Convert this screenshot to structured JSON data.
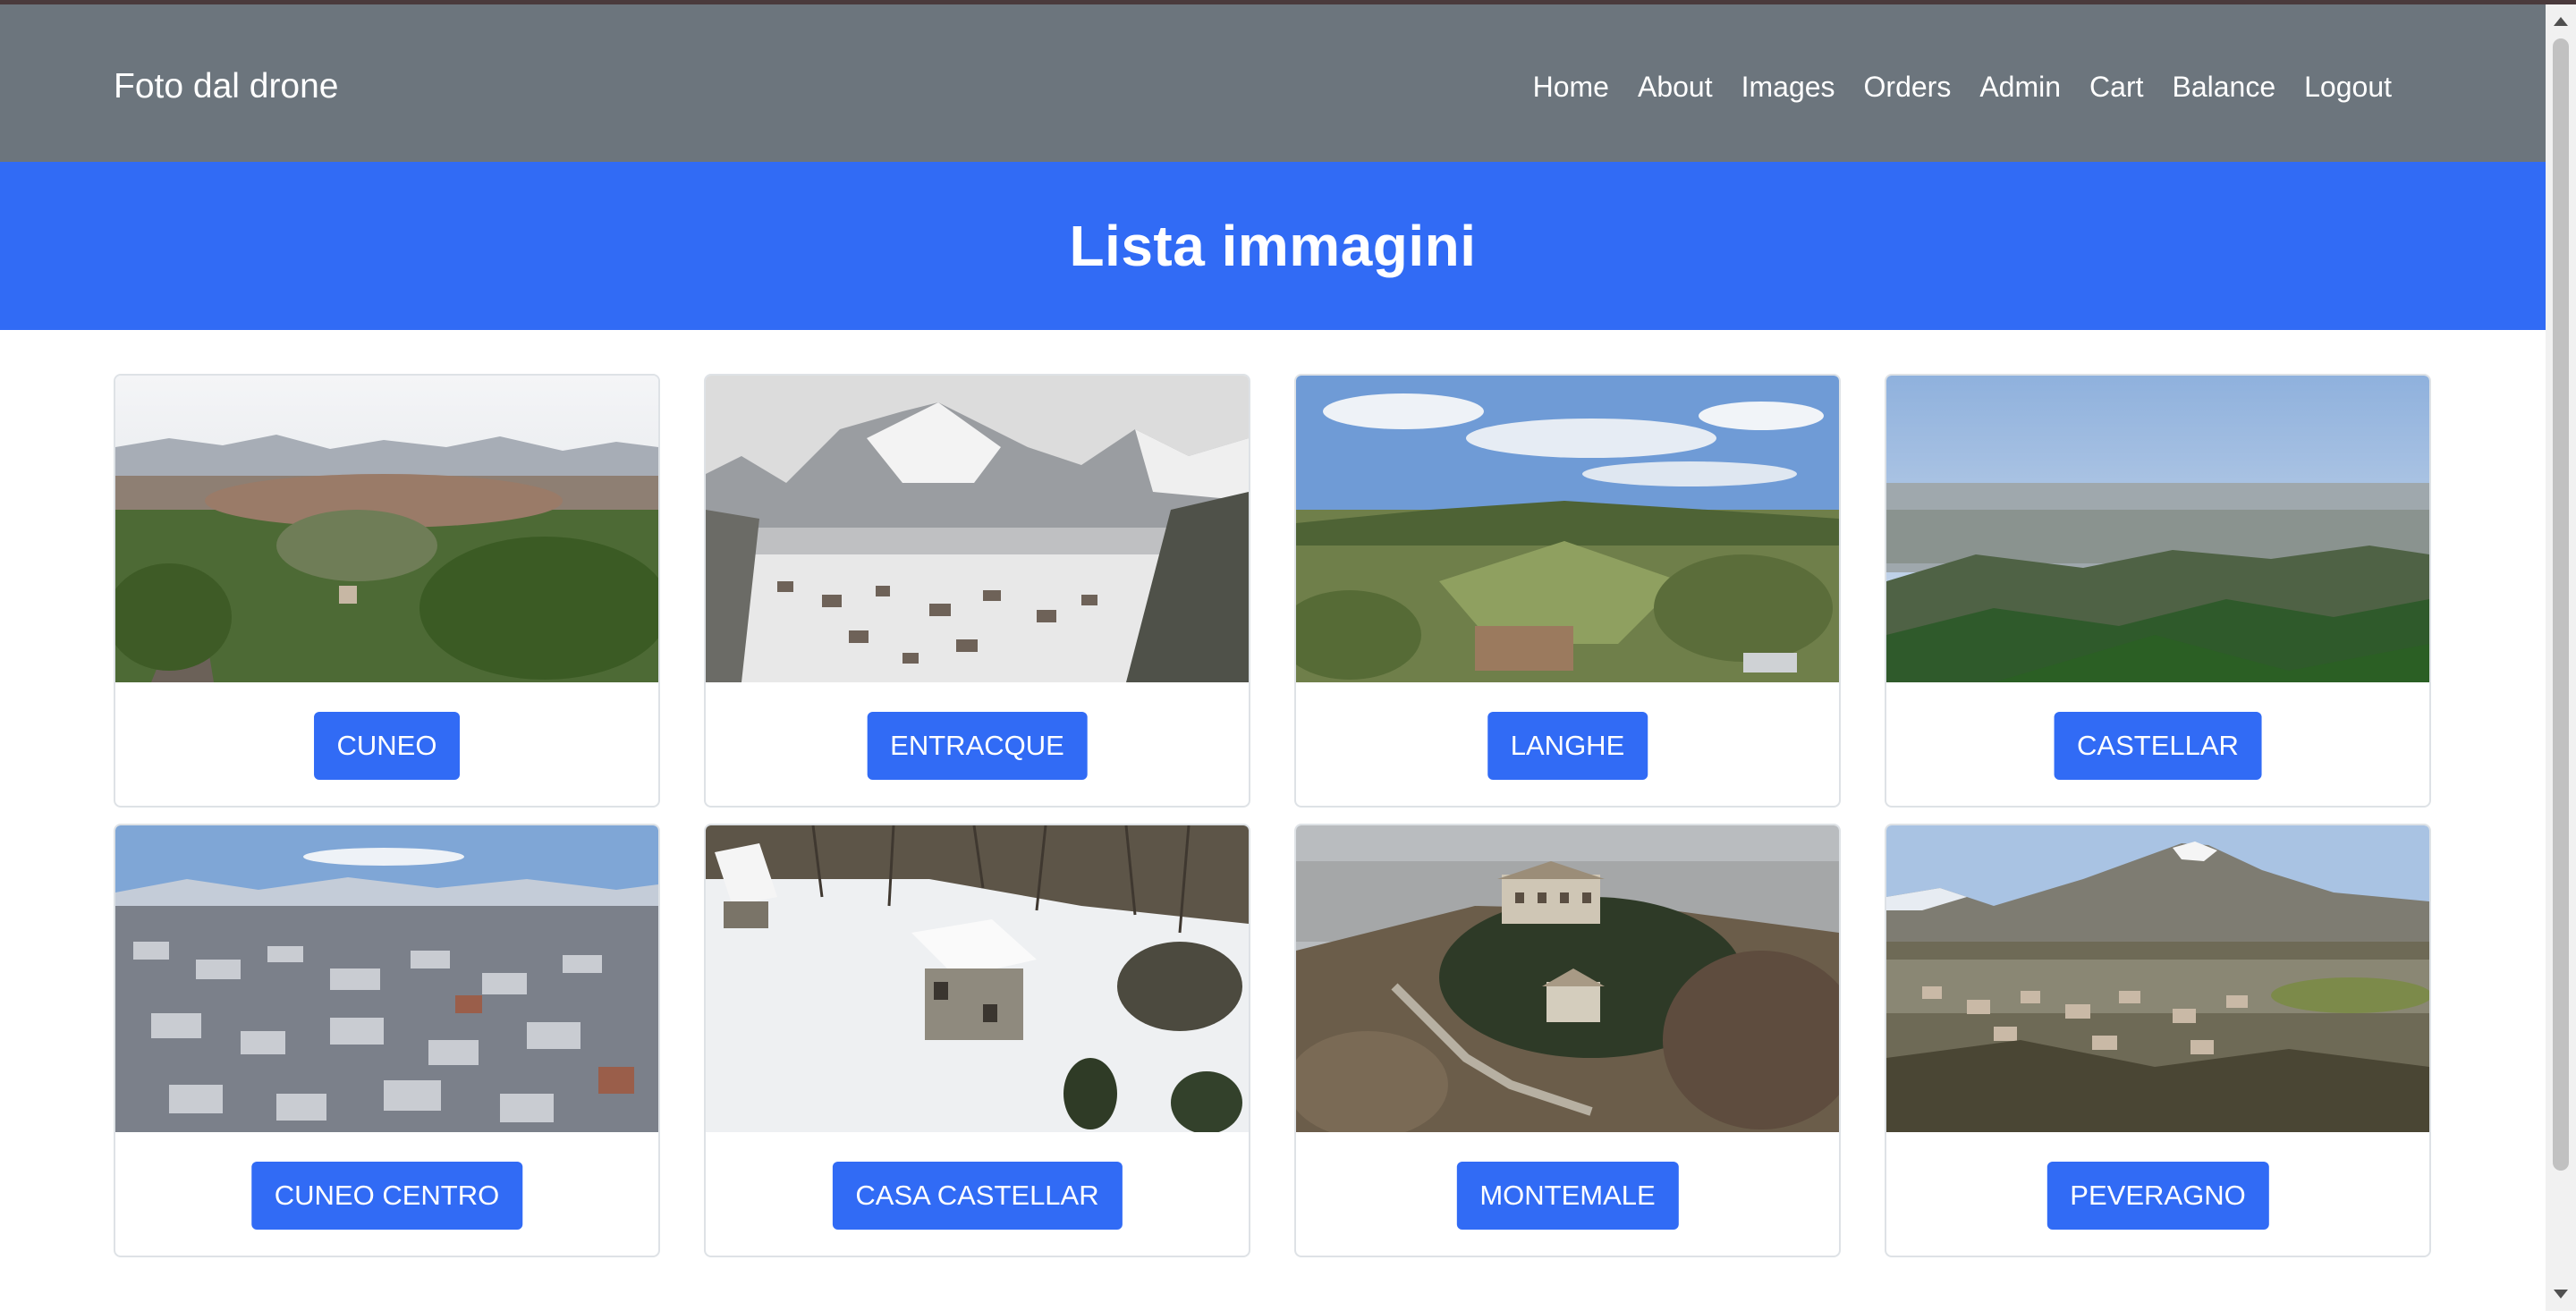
{
  "navbar": {
    "brand": "Foto dal drone",
    "links": [
      "Home",
      "About",
      "Images",
      "Orders",
      "Admin",
      "Cart",
      "Balance",
      "Logout"
    ]
  },
  "banner": {
    "title": "Lista immagini"
  },
  "cards": [
    {
      "label": "CUNEO"
    },
    {
      "label": "ENTRACQUE"
    },
    {
      "label": "LANGHE"
    },
    {
      "label": "CASTELLAR"
    },
    {
      "label": "CUNEO CENTRO"
    },
    {
      "label": "CASA CASTELLAR"
    },
    {
      "label": "MONTEMALE"
    },
    {
      "label": "PEVERAGNO"
    }
  ],
  "colors": {
    "navbar": "#6c757d",
    "primary": "#316bf5",
    "card_border": "#dee2e6"
  }
}
